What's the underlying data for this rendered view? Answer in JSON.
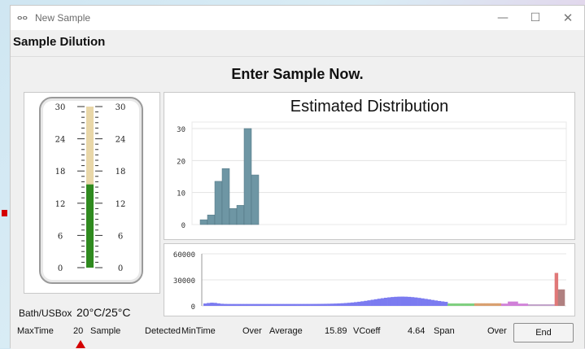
{
  "window": {
    "title": "New Sample",
    "app_icon_text": "ⴰⴰ",
    "controls": {
      "minimize": "—",
      "maximize": "☐",
      "close": "✕"
    }
  },
  "dialog": {
    "header": "Sample Dilution",
    "prompt": "Enter Sample Now."
  },
  "thermometer": {
    "ticks": [
      "30",
      "24",
      "18",
      "12",
      "6",
      "0"
    ],
    "scale_max": 30,
    "level": 15.5,
    "tube_color": "#e9d7a8",
    "fill_color": "#2f8a1f"
  },
  "bath": {
    "label": "Bath/USBox",
    "value": "20°C/25°C"
  },
  "chart_data": [
    {
      "type": "bar",
      "title": "Estimated Distribution",
      "xlabel": "",
      "ylabel": "",
      "ylim": [
        0,
        30
      ],
      "yticks": [
        "30",
        "20",
        "10",
        "0"
      ],
      "values": [
        1.5,
        3,
        13.5,
        17.5,
        5,
        6,
        30,
        15.5
      ],
      "color": "#6e96a4",
      "grid": true
    },
    {
      "type": "bar",
      "title": "",
      "xlabel": "",
      "ylabel": "",
      "ylim": [
        0,
        60000
      ],
      "yticks": [
        "60000",
        "30000",
        "0"
      ],
      "bins": 108,
      "profile": "low flat baseline, broad blue hump peaking near 10000 about 55% across, small green/orange/magenta clusters at right, tall red spike near 38000 and a brown bar near 19000 at far right",
      "spike_values": [
        38000,
        19000
      ]
    }
  ],
  "status": {
    "maxtime_label": "MaxTime",
    "maxtime_value": "20",
    "sample_label": "Sample",
    "detected_label": "Detected",
    "mintime_label": "MinTime",
    "mintime_value": "Over",
    "average_label": "Average",
    "average_value": "15.89",
    "vcoeff_label": "VCoeff",
    "vcoeff_value": "4.64",
    "span_label": "Span",
    "span_value": "Over"
  },
  "buttons": {
    "end": "End"
  },
  "colors": {
    "red_spike": "#e07878",
    "brown_bar": "#b08080",
    "blue_hump": "#7b7bf0",
    "green_cluster": "#7fcf7f",
    "orange_cluster": "#d9a070",
    "magenta_cluster": "#d080d8"
  }
}
